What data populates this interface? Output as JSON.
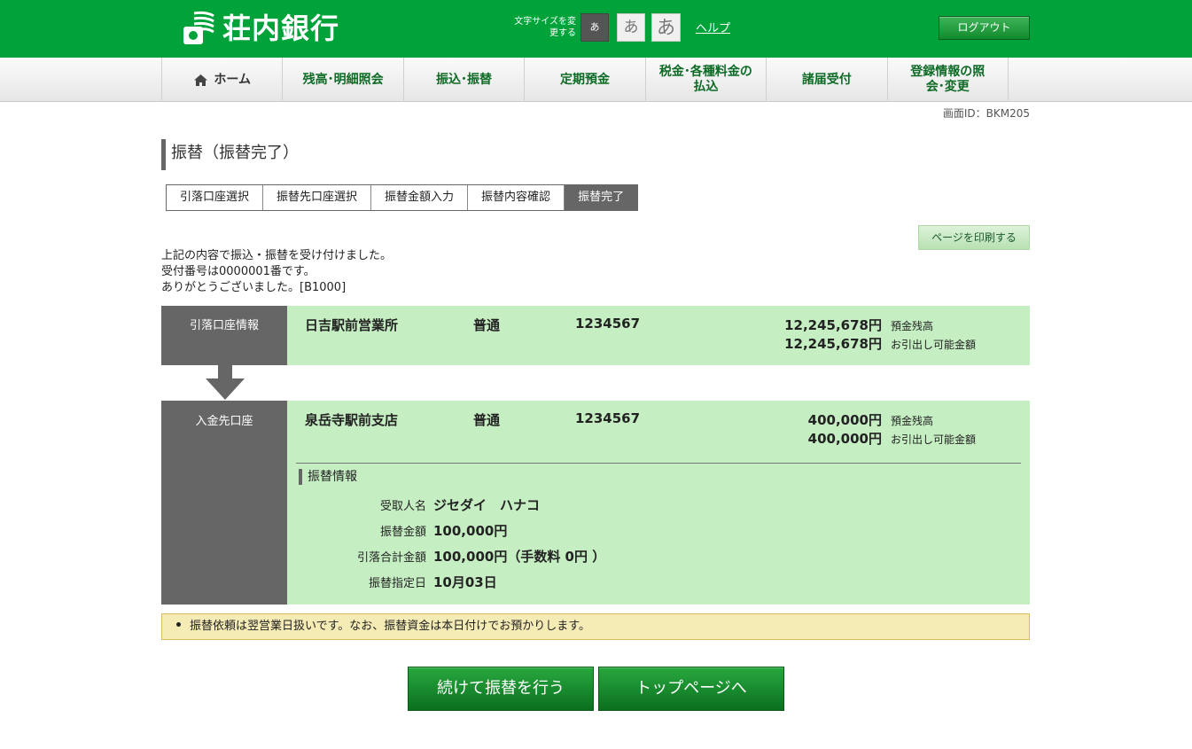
{
  "header": {
    "bank_name": "荘内銀行",
    "font_size_label": "文字サイズを変更する",
    "font_size_options": [
      "あ",
      "あ",
      "あ"
    ],
    "help_label": "ヘルプ",
    "logout_label": "ログアウト"
  },
  "nav": {
    "home": "ホーム",
    "items": [
      "残高･明細照会",
      "振込･振替",
      "定期預金",
      "税金･各種料金の払込",
      "諸届受付",
      "登録情報の照会･変更"
    ]
  },
  "screen_id": "画面ID：BKM205",
  "page_title": "振替（振替完了）",
  "steps": [
    "引落口座選択",
    "振替先口座選択",
    "振替金額入力",
    "振替内容確認",
    "振替完了"
  ],
  "print_label": "ページを印刷する",
  "messages": {
    "line1": "上記の内容で振込・振替を受け付けました。",
    "line2": "受付番号は0000001番です。",
    "line3": "ありがとうございました。[B1000]"
  },
  "from_account": {
    "label": "引落口座情報",
    "branch": "日吉駅前営業所",
    "type": "普通",
    "number": "1234567",
    "balance": "12,245,678円",
    "balance_label": "預金残高",
    "available": "12,245,678円",
    "available_label": "お引出し可能金額"
  },
  "to_account": {
    "label": "入金先口座",
    "branch": "泉岳寺駅前支店",
    "type": "普通",
    "number": "1234567",
    "balance": "400,000円",
    "balance_label": "預金残高",
    "available": "400,000円",
    "available_label": "お引出し可能金額"
  },
  "transfer_info": {
    "title": "振替情報",
    "recipient_label": "受取人名",
    "recipient": "ジセダイ　ハナコ",
    "amount_label": "振替金額",
    "amount": "100,000円",
    "total_label": "引落合計金額",
    "total": "100,000円（手数料 0円 ）",
    "date_label": "振替指定日",
    "date": "10月03日"
  },
  "note": "振替依頼は翌営業日扱いです。なお、振替資金は本日付けでお預かりします。",
  "buttons": {
    "continue": "続けて振替を行う",
    "top": "トップページへ"
  },
  "colors": {
    "brand_green": "#00a23a",
    "panel_green": "#c6eec3",
    "label_gray": "#666666",
    "note_yellow": "#f5ebb5"
  }
}
